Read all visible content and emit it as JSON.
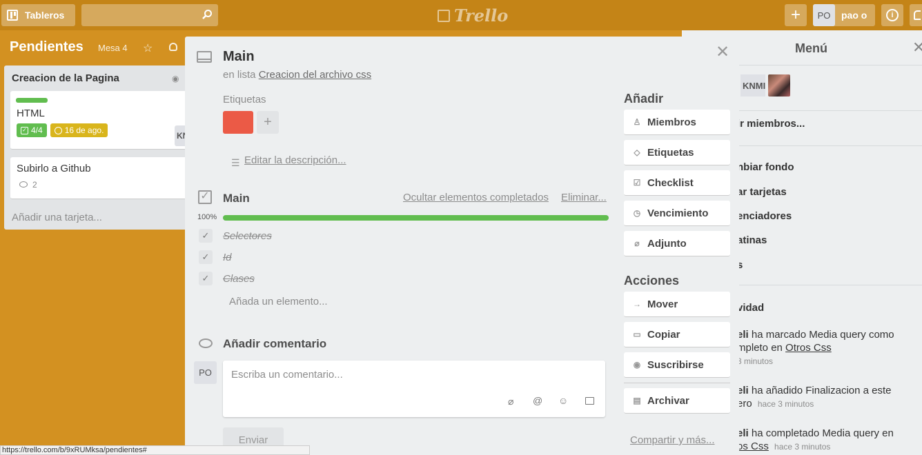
{
  "topbar": {
    "boards_label": "Tableros",
    "logo_text": "Trello",
    "plus_label": "+",
    "user_initials": "PO",
    "user_name": "pao o",
    "info_label": "i"
  },
  "board": {
    "title": "Pendientes",
    "team": "Mesa 4"
  },
  "list": {
    "title": "Creacion de la Pagina",
    "cards": [
      {
        "title": "HTML",
        "checklist_badge": "4/4",
        "due_badge": "16 de ago.",
        "member": "KN"
      },
      {
        "title": "Subirlo a Github",
        "comments": "2"
      }
    ],
    "add_card": "Añadir una tarjeta..."
  },
  "menu": {
    "title": "Menú",
    "member_initials": "KNMI",
    "add_members": "ir miembros...",
    "items": [
      "nbiar fondo",
      "ar tarjetas",
      "enciadores",
      "atinas",
      "s"
    ],
    "activity_title": "vidad",
    "activities": [
      {
        "user": "eli",
        "text_a": "ha marcado Media query como",
        "text_b": "mpleto en",
        "link": "Otros Css",
        "time": "3 minutos"
      },
      {
        "user": "eli",
        "text_a": "ha añadido Finalizacion a este",
        "text_b": "ero",
        "link": "",
        "time": "hace 3 minutos"
      },
      {
        "user": "eli",
        "text_a": "ha completado Media query en",
        "text_b": "",
        "link": "os Css",
        "time": "hace 3 minutos"
      }
    ]
  },
  "modal": {
    "title": "Main",
    "in_list_prefix": "en lista",
    "in_list_link": "Creacion del archivo css",
    "labels_heading": "Etiquetas",
    "label_color": "#eb5a46",
    "add_label": "+",
    "edit_description": "Editar la descripción...",
    "checklist": {
      "title": "Main",
      "hide_completed": "Ocultar elementos completados",
      "delete": "Eliminar...",
      "progress_text": "100%",
      "progress": 100,
      "items": [
        "Selectores",
        "Id",
        "Clases"
      ],
      "add_item": "Añada un elemento..."
    },
    "comment": {
      "heading": "Añadir comentario",
      "avatar": "PO",
      "placeholder": "Escriba un comentario...",
      "send": "Enviar"
    },
    "add_section": {
      "heading": "Añadir",
      "buttons": [
        "Miembros",
        "Etiquetas",
        "Checklist",
        "Vencimiento",
        "Adjunto"
      ]
    },
    "actions_section": {
      "heading": "Acciones",
      "buttons": [
        "Mover",
        "Copiar",
        "Suscribirse",
        "Archivar"
      ]
    },
    "share": "Compartir y más..."
  },
  "status_url": "https://trello.com/b/9xRUMksa/pendientes#",
  "colors": {
    "board_bg": "#d39121",
    "progress": "#61bd4f",
    "label_green": "#61bd4f",
    "due_yellow": "#d9b51c"
  }
}
